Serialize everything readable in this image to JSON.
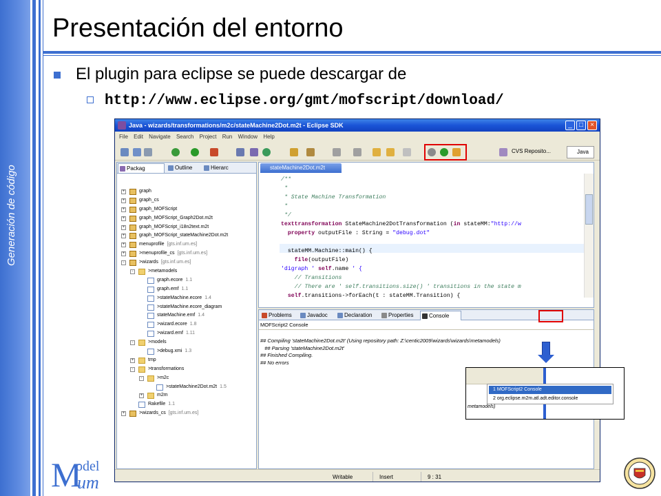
{
  "slide": {
    "side_label": "Generación de código",
    "title": "Presentación del entorno",
    "bullet": "El plugin para eclipse se puede descargar de",
    "url": "http://www.eclipse.org/gmt/mofscript/download/",
    "logo_line1": "odel",
    "logo_line2": "um",
    "logo_letter": "M"
  },
  "window": {
    "title": "Java - wizards/transformations/m2c/stateMachine2Dot.m2t - Eclipse SDK",
    "menu": [
      "File",
      "Edit",
      "Navigate",
      "Search",
      "Project",
      "Run",
      "Window",
      "Help"
    ],
    "perspective": "CVS Reposito...",
    "java": "Java"
  },
  "explorer": {
    "tabs": [
      "Packag",
      "Outline",
      "Hierarc"
    ],
    "tree": [
      {
        "label": "graph",
        "ver": "",
        "depth": 0,
        "exp": "+",
        "kind": "proj"
      },
      {
        "label": "graph_cs",
        "ver": "",
        "depth": 0,
        "exp": "+",
        "kind": "proj"
      },
      {
        "label": "graph_MOFScript",
        "ver": "",
        "depth": 0,
        "exp": "+",
        "kind": "proj"
      },
      {
        "label": "graph_MOFScript_Graph2Dot.m2t",
        "ver": "",
        "depth": 0,
        "exp": "+",
        "kind": "proj"
      },
      {
        "label": "graph_MOFScript_i18n2text.m2t",
        "ver": "",
        "depth": 0,
        "exp": "+",
        "kind": "proj"
      },
      {
        "label": "graph_MOFScript_stateMachine2Dot.m2t",
        "ver": "",
        "depth": 0,
        "exp": "+",
        "kind": "proj"
      },
      {
        "label": "menuprofile",
        "ver": "[gts.inf.um.es]",
        "depth": 0,
        "exp": "+",
        "kind": "proj"
      },
      {
        "label": ">menuprofile_cs",
        "ver": "[gts.inf.um.es]",
        "depth": 0,
        "exp": "+",
        "kind": "proj"
      },
      {
        "label": ">wizards",
        "ver": "[gts.inf.um.es]",
        "depth": 0,
        "exp": "-",
        "kind": "proj"
      },
      {
        "label": ">metamodels",
        "ver": "",
        "depth": 1,
        "exp": "-",
        "kind": "folder"
      },
      {
        "label": "graph.ecore",
        "ver": "1.1",
        "depth": 2,
        "exp": "",
        "kind": "file"
      },
      {
        "label": "graph.emf",
        "ver": "1.1",
        "depth": 2,
        "exp": "",
        "kind": "file"
      },
      {
        "label": ">stateMachine.ecore",
        "ver": "1.4",
        "depth": 2,
        "exp": "",
        "kind": "file"
      },
      {
        "label": ">stateMachine.ecore_diagram",
        "ver": "",
        "depth": 2,
        "exp": "",
        "kind": "file"
      },
      {
        "label": "stateMachine.emf",
        "ver": "1.4",
        "depth": 2,
        "exp": "",
        "kind": "file"
      },
      {
        "label": ">wizard.ecore",
        "ver": "1.8",
        "depth": 2,
        "exp": "",
        "kind": "file"
      },
      {
        "label": ">wizard.emf",
        "ver": "1.11",
        "depth": 2,
        "exp": "",
        "kind": "file"
      },
      {
        "label": ">models",
        "ver": "",
        "depth": 1,
        "exp": "-",
        "kind": "folder"
      },
      {
        "label": ">debug.xmi",
        "ver": "1.3",
        "depth": 2,
        "exp": "",
        "kind": "file"
      },
      {
        "label": "tmp",
        "ver": "",
        "depth": 1,
        "exp": "+",
        "kind": "folder"
      },
      {
        "label": ">transformations",
        "ver": "",
        "depth": 1,
        "exp": "-",
        "kind": "folder"
      },
      {
        "label": ">m2c",
        "ver": "",
        "depth": 2,
        "exp": "-",
        "kind": "folder"
      },
      {
        "label": ">stateMachine2Dot.m2t",
        "ver": "1.5",
        "depth": 3,
        "exp": "",
        "kind": "file"
      },
      {
        "label": "m2m",
        "ver": "",
        "depth": 2,
        "exp": "+",
        "kind": "folder"
      },
      {
        "label": "Rakefile",
        "ver": "1.1",
        "depth": 1,
        "exp": "",
        "kind": "file"
      },
      {
        "label": ">wizards_cs",
        "ver": "[gts.inf.um.es]",
        "depth": 0,
        "exp": "+",
        "kind": "proj"
      }
    ]
  },
  "editor": {
    "tab": "stateMachine2Dot.m2t",
    "lines": [
      "/**",
      " *",
      " * State Machine Transformation",
      " *",
      " */",
      "texttransformation StateMachine2DotTransformation (in stateMM:\"http://w",
      "  property outputFile : String = \"debug.dot\"",
      "",
      "  stateMM.Machine::main() {",
      "    file(outputFile)",
      "'digraph ' self.name ' {",
      "    // Transitions",
      "    // There are ' self.transitions.size() ' transitions in the state m",
      "  self.transitions->forEach(t : stateMM.Transition) {"
    ]
  },
  "console": {
    "tabs": [
      "Problems",
      "Javadoc",
      "Declaration",
      "Properties",
      "Console"
    ],
    "header": "MOFScript2 Console",
    "output": [
      "## Compiling 'stateMachine2Dot.m2t' (Using repository path: Z:\\centic2009\\wizards\\wizards\\metamodels)",
      "   ## Parsing 'stateMachine2Dot.m2t'",
      "## Finished Compiling.",
      "## No errors"
    ]
  },
  "status": {
    "mode": "Writable",
    "insert": "Insert",
    "position": "9 : 31"
  },
  "zoom": {
    "item1": "1 MOFScript2 Console",
    "item2": "2 org.eclipse.m2m.atl.adt.editor.console",
    "meta": "metamodels)"
  }
}
